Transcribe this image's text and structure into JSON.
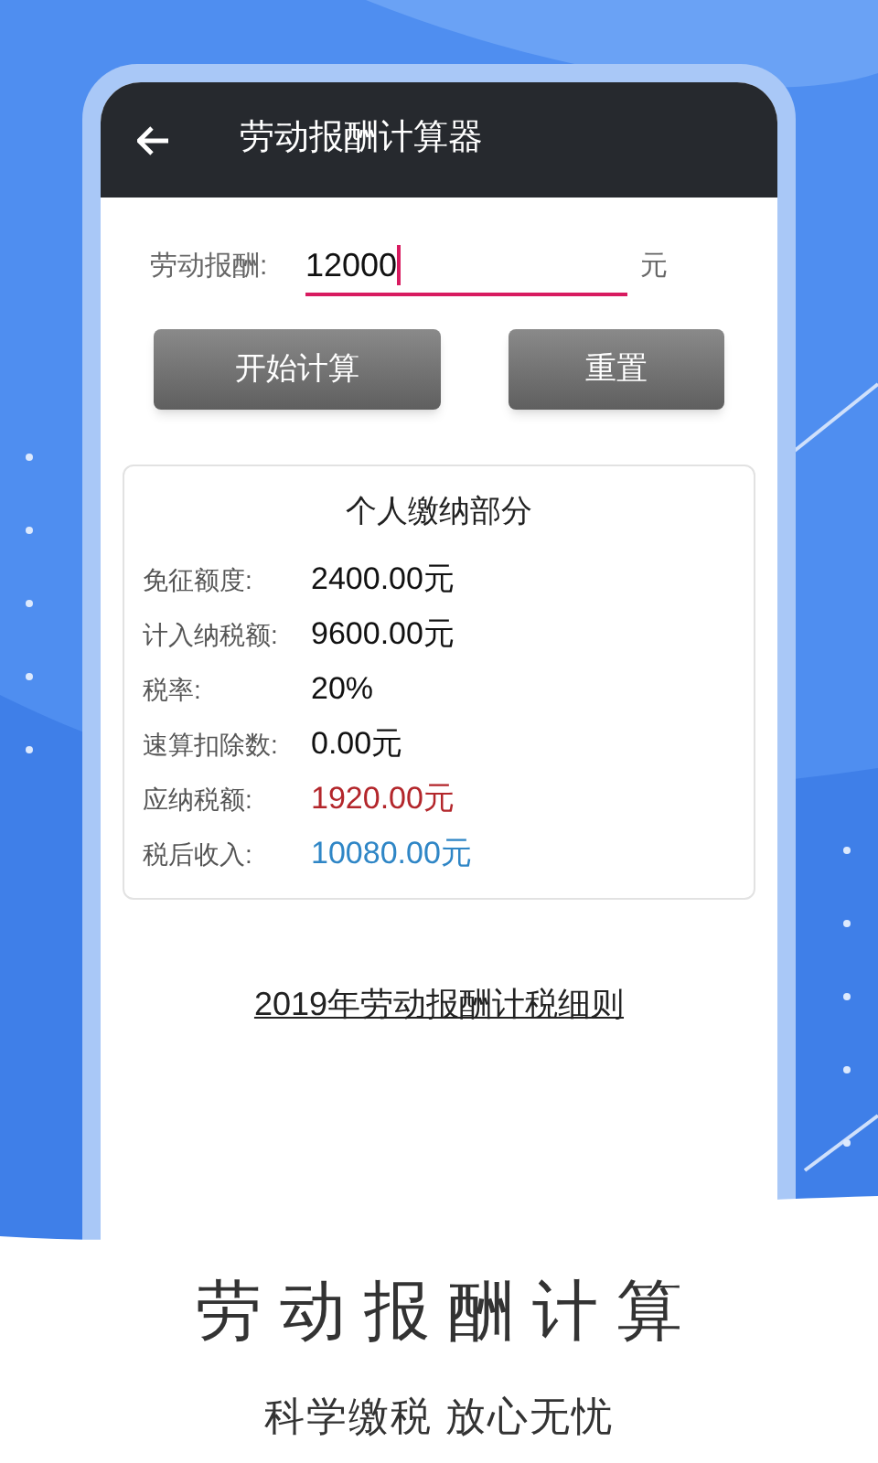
{
  "app_bar": {
    "title": "劳动报酬计算器"
  },
  "input": {
    "label": "劳动报酬:",
    "value": "12000",
    "unit": "元",
    "focused": true
  },
  "buttons": [
    "开始计算",
    "重置"
  ],
  "result_card": {
    "title": "个人缴纳部分",
    "rows": [
      {
        "label": "免征额度:",
        "value": "2400.00元",
        "color": "#111111"
      },
      {
        "label": "计入纳税额:",
        "value": "9600.00元",
        "color": "#111111"
      },
      {
        "label": "税率:",
        "value": "20%",
        "color": "#111111"
      },
      {
        "label": "速算扣除数:",
        "value": "0.00元",
        "color": "#111111"
      },
      {
        "label": "应纳税额:",
        "value": "1920.00元",
        "color": "#b3262b"
      },
      {
        "label": "税后收入:",
        "value": "10080.00元",
        "color": "#2f86c6"
      }
    ]
  },
  "rules_link": "2019年劳动报酬计税细则",
  "promo": {
    "headline": "劳动报酬计算",
    "tagline": "科学缴税 放心无忧"
  }
}
